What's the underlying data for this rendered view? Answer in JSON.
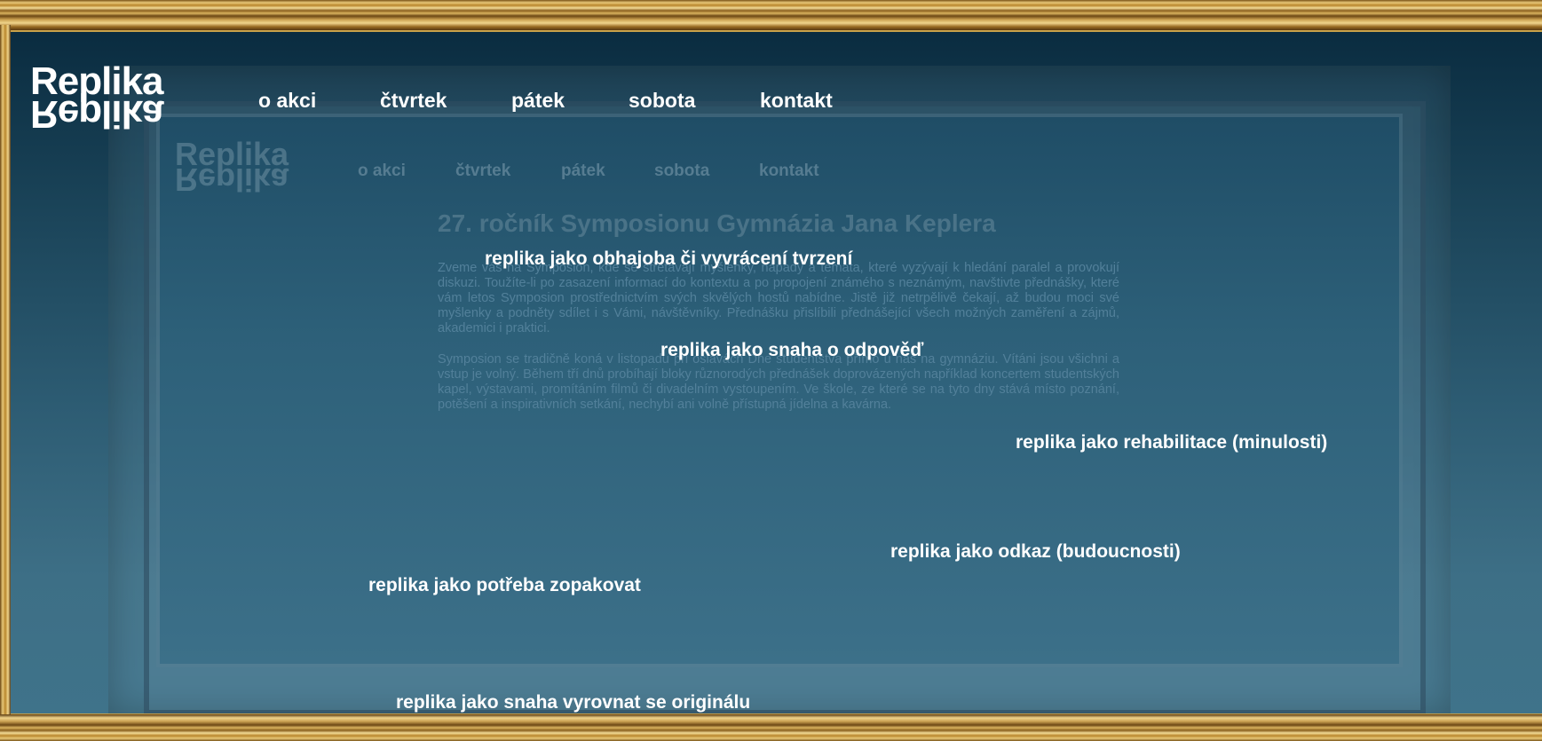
{
  "brand": {
    "logo_top": "Replika",
    "logo_bottom": "Replika"
  },
  "nav": {
    "items": [
      {
        "label": "o akci"
      },
      {
        "label": "čtvrtek"
      },
      {
        "label": "pátek"
      },
      {
        "label": "sobota"
      },
      {
        "label": "kontakt"
      }
    ]
  },
  "article": {
    "title": "27. ročník Symposionu Gymnázia Jana Keplera",
    "paragraph1": "Zveme vás na Symposion, kde se střetávají myšlenky, nápady a témata, které vyzývají k hledání paralel a provokují diskuzi. Toužíte-li po zasazení informací do kontextu a po propojení známého s neznámým, navštivte přednášky, které vám letos Symposion prostřednictvím svých skvělých hostů nabídne. Jistě již netrpělivě čekají, až budou moci své myšlenky a podněty sdílet i s Vámi, návštěvníky. Přednášku přislíbili přednášející všech možných zaměření a zájmů, akademici i praktici.",
    "paragraph2": "Symposion se tradičně koná v listopadu při oslavách Dne studentstva přímo u nás na gymnáziu. Vítáni jsou všichni a vstup je volný. Během tří dnů probíhají bloky různorodých přednášek doprovázených například koncertem studentských kapel, výstavami, promítáním filmů či divadelním vystoupením. Ve škole, ze které se na tyto dny stává místo poznání, potěšení a inspirativních setkání, nechybí ani volně přístupná jídelna a kavárna."
  },
  "phrases": [
    {
      "text": "replika jako obhajoba či vyvrácení tvrzení"
    },
    {
      "text": "replika jako snaha o odpověď"
    },
    {
      "text": "replika jako rehabilitace (minulosti)"
    },
    {
      "text": "replika jako odkaz (budoucnosti)"
    },
    {
      "text": "replika jako potřeba zopakovat"
    },
    {
      "text": "replika jako snaha vyrovnat se originálu"
    }
  ],
  "colors": {
    "frame_gold": "#c9a24a",
    "background_dark": "#0a2c40",
    "background_light": "#3f738a",
    "text": "#ffffff"
  }
}
